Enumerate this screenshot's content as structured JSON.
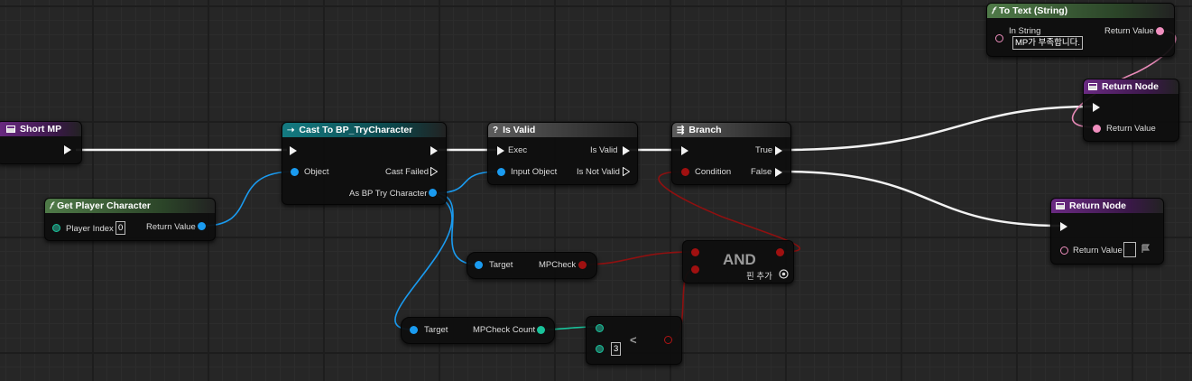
{
  "nodes": {
    "short_mp": {
      "title": "Short MP"
    },
    "get_player_character": {
      "title": "Get Player Character",
      "function_icon": "f",
      "player_index_label": "Player Index",
      "player_index_value": "0",
      "return_value_label": "Return Value"
    },
    "cast": {
      "title": "Cast To BP_TryCharacter",
      "object_label": "Object",
      "cast_failed_label": "Cast Failed",
      "as_label": "As BP Try Character"
    },
    "is_valid": {
      "title": "Is Valid",
      "title_icon": "?",
      "exec_label": "Exec",
      "input_object_label": "Input Object",
      "is_valid_label": "Is Valid",
      "is_not_valid_label": "Is Not Valid"
    },
    "branch": {
      "title": "Branch",
      "condition_label": "Condition",
      "true_label": "True",
      "false_label": "False"
    },
    "to_text": {
      "title": "To Text (String)",
      "function_icon": "f",
      "in_string_label": "In String",
      "in_string_value": "MP가 부족합니다.",
      "return_value_label": "Return Value"
    },
    "return_node_top": {
      "title": "Return Node",
      "return_value_label": "Return Value"
    },
    "return_node_bottom": {
      "title": "Return Node",
      "return_value_label": "Return Value"
    },
    "get_mpcheck": {
      "target_label": "Target",
      "output_label": "MPCheck"
    },
    "get_mpcheck_count": {
      "target_label": "Target",
      "output_label": "MPCheck Count"
    },
    "and_node": {
      "title": "AND",
      "add_pin_label": "핀 추가"
    },
    "less_node": {
      "operator": "<",
      "b_value": "3"
    }
  },
  "colors": {
    "exec_wire": "#f2f2f2",
    "object_wire": "#1a9bf0",
    "bool_wire": "#8f1010",
    "int_wire": "#19c29a",
    "text_wire": "#e88ab8",
    "function_header": "#4f7a48",
    "macro_header": "#5c5c5c",
    "cast_header": "#147b82",
    "event_header": "#6a2a82"
  },
  "icons": {
    "function": "function-f-icon",
    "cast": "cast-arrow-icon",
    "is_valid": "question-icon",
    "branch": "branch-icon",
    "graph": "graph-box-icon",
    "add_pin": "plus-circle-icon",
    "flag": "flag-icon"
  }
}
